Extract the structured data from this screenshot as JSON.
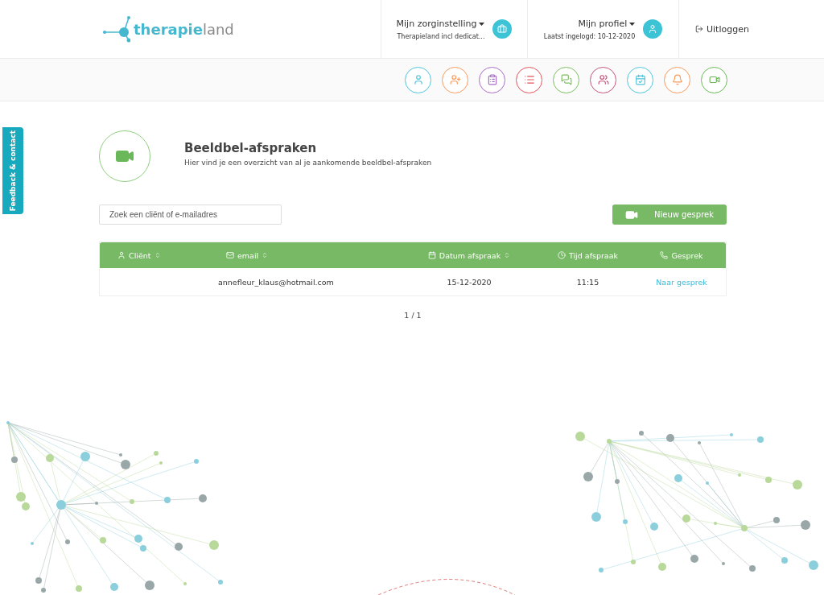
{
  "header": {
    "logo": "**therapie**land",
    "organisation": {
      "label": "Mijn zorginstelling",
      "subtitle": "Therapieland incl dedicat..."
    },
    "profile": {
      "label": "Mijn profiel",
      "subtitle": "Laatst ingelogd: 10-12-2020"
    },
    "logout": "Uitloggen"
  },
  "nav_icons": [
    {
      "kind": "user",
      "color": "#4fc3d9"
    },
    {
      "kind": "user-plus",
      "color": "#f79a5e"
    },
    {
      "kind": "clipboard",
      "color": "#a66cc4"
    },
    {
      "kind": "list",
      "color": "#e0545c"
    },
    {
      "kind": "chat",
      "color": "#7bbd5f"
    },
    {
      "kind": "group",
      "color": "#c2547a"
    },
    {
      "kind": "calendar",
      "color": "#4fc3d9"
    },
    {
      "kind": "bell",
      "color": "#f79a5e"
    },
    {
      "kind": "video",
      "color": "#6ab85a"
    }
  ],
  "feedback_tab": "Feedback & contact",
  "page": {
    "title": "Beeldbel-afspraken",
    "subtitle": "Hier vind je een overzicht van al je aankomende beeldbel-afspraken"
  },
  "search": {
    "placeholder": "Zoek een cliënt of e-mailadres"
  },
  "new_button": "Nieuw gesprek",
  "table": {
    "columns": [
      {
        "label": "Cliënt",
        "kind": "user",
        "sortable": true
      },
      {
        "label": "email",
        "kind": "mail",
        "sortable": true
      },
      {
        "label": "Datum afspraak",
        "kind": "calendar",
        "sortable": true
      },
      {
        "label": "Tijd afspraak",
        "kind": "clock",
        "sortable": false
      },
      {
        "label": "Gesprek",
        "kind": "phone",
        "sortable": false
      }
    ],
    "rows": [
      {
        "client": "",
        "email": "annefleur_klaus@hotmail.com",
        "date": "15-12-2020",
        "time": "11:15",
        "link": "Naar gesprek"
      }
    ]
  },
  "pagination": "1 / 1"
}
